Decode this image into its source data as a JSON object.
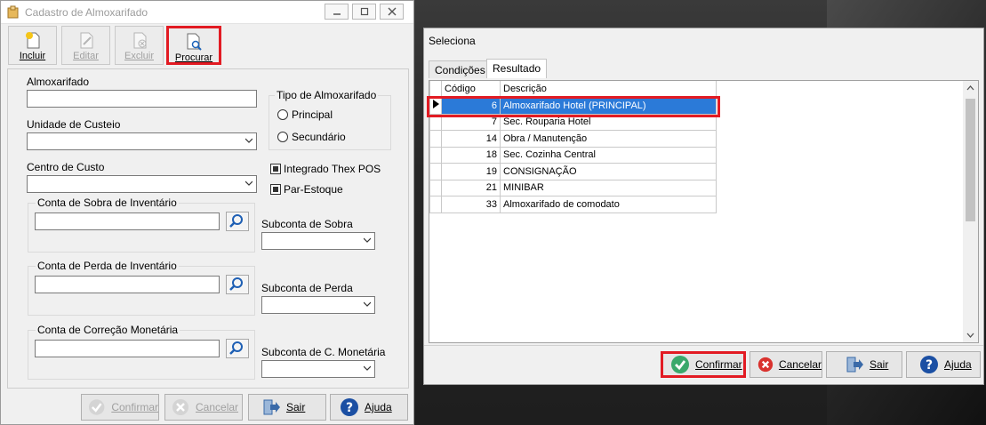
{
  "main_window": {
    "title": "Cadastro de Almoxarifado",
    "toolbar": {
      "incluir": "Incluir",
      "editar": "Editar",
      "excluir": "Excluir",
      "procurar": "Procurar"
    },
    "form": {
      "almoxarifado_label": "Almoxarifado",
      "almoxarifado_value": "",
      "unidade_label": "Unidade de Custeio",
      "centro_label": "Centro de Custo",
      "tipo_title": "Tipo de Almoxarifado",
      "tipo_principal": "Principal",
      "tipo_secundario": "Secundário",
      "integrado": "Integrado Thex POS",
      "par_estoque": "Par-Estoque",
      "conta_sobra": "Conta de Sobra de Inventário",
      "conta_perda": "Conta de Perda de Inventário",
      "conta_correcao": "Conta de Correção Monetária",
      "sub_sobra": "Subconta de Sobra",
      "sub_perda": "Subconta de Perda",
      "sub_correcao": "Subconta de C. Monetária"
    },
    "buttons": {
      "confirmar": "Confirmar",
      "cancelar": "Cancelar",
      "sair": "Sair",
      "ajuda": "Ajuda"
    }
  },
  "select_window": {
    "title": "Seleciona",
    "tabs": [
      "Condições",
      "Resultado"
    ],
    "columns": {
      "codigo": "Código",
      "descricao": "Descrição"
    },
    "rows": [
      {
        "codigo": "6",
        "descricao": "Almoxarifado Hotel (PRINCIPAL)"
      },
      {
        "codigo": "7",
        "descricao": "Sec. Rouparia Hotel"
      },
      {
        "codigo": "14",
        "descricao": "Obra / Manutenção"
      },
      {
        "codigo": "18",
        "descricao": "Sec. Cozinha Central"
      },
      {
        "codigo": "19",
        "descricao": "CONSIGNAÇÃO"
      },
      {
        "codigo": "21",
        "descricao": "MINIBAR"
      },
      {
        "codigo": "33",
        "descricao": "Almoxarifado de comodato"
      }
    ],
    "buttons": {
      "confirmar": "Confirmar",
      "cancelar": "Cancelar",
      "sair": "Sair",
      "ajuda": "Ajuda"
    }
  },
  "colors": {
    "highlight": "#e21b23",
    "selection": "#2b7ad8",
    "help": "#1b4fa3"
  }
}
